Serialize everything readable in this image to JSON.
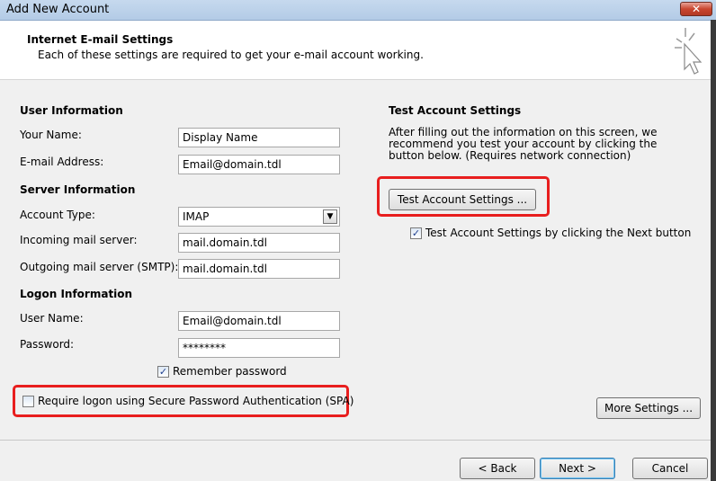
{
  "window": {
    "title": "Add New Account",
    "close_label": "✕"
  },
  "header": {
    "title": "Internet E-mail Settings",
    "subtitle": "Each of these settings are required to get your e-mail account working."
  },
  "user_info": {
    "section": "User Information",
    "name_label": "Your Name:",
    "name_value": "Display Name",
    "email_label": "E-mail Address:",
    "email_value": "Email@domain.tdl"
  },
  "server_info": {
    "section": "Server Information",
    "account_type_label": "Account Type:",
    "account_type_value": "IMAP",
    "incoming_label": "Incoming mail server:",
    "incoming_value": "mail.domain.tdl",
    "outgoing_label": "Outgoing mail server (SMTP):",
    "outgoing_value": "mail.domain.tdl"
  },
  "logon_info": {
    "section": "Logon Information",
    "username_label": "User Name:",
    "username_value": "Email@domain.tdl",
    "password_label": "Password:",
    "password_value": "********",
    "remember_label": "Remember password",
    "remember_checked": true,
    "spa_label": "Require logon using Secure Password Authentication (SPA)",
    "spa_checked": false
  },
  "test_settings": {
    "section": "Test Account Settings",
    "description": "After filling out the information on this screen, we recommend you test your account by clicking the button below. (Requires network connection)",
    "button_label": "Test Account Settings ...",
    "next_check_label": "Test Account Settings by clicking the Next button",
    "next_check_checked": true
  },
  "buttons": {
    "more_settings": "More Settings ...",
    "back": "< Back",
    "next": "Next >",
    "cancel": "Cancel"
  },
  "colors": {
    "highlight": "#e81e1e",
    "title_bar": "#c6d9ee"
  },
  "icons": {
    "check": "✓",
    "dropdown": "▼",
    "wizard": "cursor-sparkle-icon"
  }
}
